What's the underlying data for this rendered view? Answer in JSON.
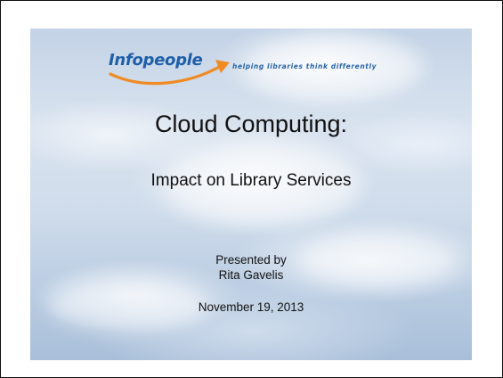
{
  "slide": {
    "logo": {
      "name": "Infopeople",
      "tagline": "helping libraries think differently"
    },
    "title": "Cloud Computing:",
    "subtitle": "Impact on Library Services",
    "presented_by": "Presented by",
    "presenter": "Rita Gavelis",
    "date": "November 19, 2013"
  },
  "colors": {
    "logo_blue": "#1f5fa8",
    "logo_orange": "#f08a24",
    "text": "#111111"
  }
}
